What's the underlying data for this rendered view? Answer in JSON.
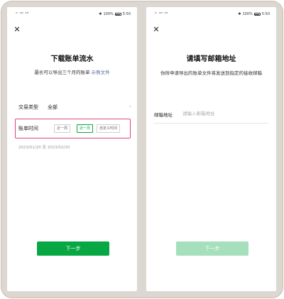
{
  "status_bar": {
    "left_icons": "ᵐ ⁴ᴳ ⁴ᴳ",
    "battery_text": "100%",
    "time": "5:50"
  },
  "left_screen": {
    "title": "下载账单流水",
    "subtitle_text": "最长可以导出三个月的账单",
    "subtitle_link": "示例文件",
    "transaction_type_label": "交易类型",
    "transaction_type_value": "全部",
    "time_label": "账单时间",
    "chips": [
      {
        "label": "近一周",
        "active": false
      },
      {
        "label": "近一月",
        "active": true
      },
      {
        "label": "自定义时间",
        "active": false
      }
    ],
    "date_range": "2023/01/20 至 2023/02/20",
    "next_label": "下一步"
  },
  "right_screen": {
    "title": "请填写邮箱地址",
    "description": "你所申请导出的账单文件将发送到指定的接收邮箱",
    "email_label": "邮箱地址",
    "email_placeholder": "请输入邮箱地址",
    "email_value": "",
    "next_label": "下一步"
  },
  "colors": {
    "accent_green": "#07a844",
    "disabled_green": "#a6dfbb",
    "highlight_pink": "#e0457a",
    "link_blue": "#4b6c9a"
  }
}
